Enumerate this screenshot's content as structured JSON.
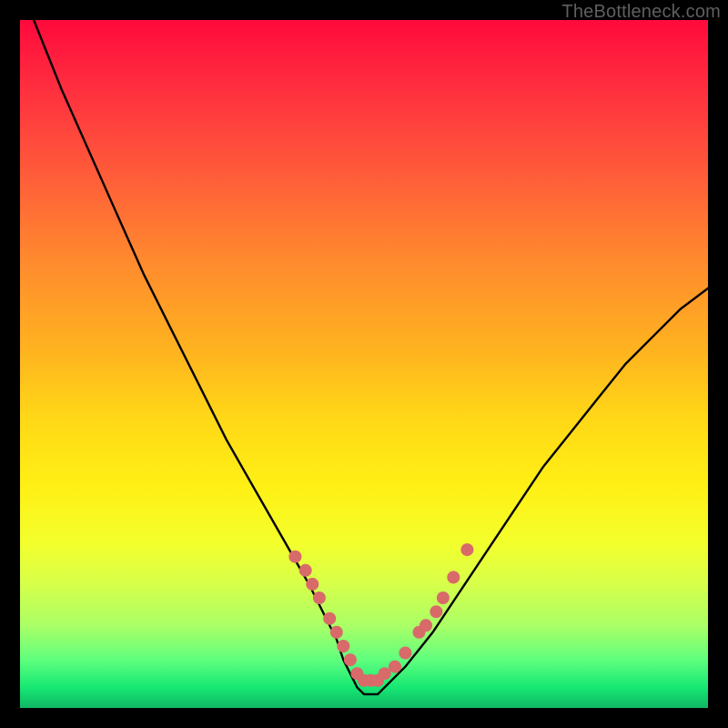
{
  "watermark": "TheBottleneck.com",
  "colors": {
    "frame_bg": "#000000",
    "marker": "#d86a6a",
    "line": "#000000",
    "gradient_top": "#ff0a3c",
    "gradient_bottom": "#0fb765"
  },
  "chart_data": {
    "type": "line",
    "title": "",
    "xlabel": "",
    "ylabel": "",
    "xlim": [
      0,
      100
    ],
    "ylim": [
      0,
      100
    ],
    "grid": false,
    "legend": false,
    "x": [
      2,
      6,
      10,
      14,
      18,
      22,
      26,
      30,
      34,
      38,
      42,
      46,
      47,
      48,
      49,
      50,
      51,
      52,
      53,
      54,
      56,
      60,
      64,
      68,
      72,
      76,
      80,
      84,
      88,
      92,
      96,
      100
    ],
    "y": [
      100,
      90,
      81,
      72,
      63,
      55,
      47,
      39,
      32,
      25,
      18,
      10,
      7,
      5,
      3,
      2,
      2,
      2,
      3,
      4,
      6,
      11,
      17,
      23,
      29,
      35,
      40,
      45,
      50,
      54,
      58,
      61
    ],
    "markers": {
      "x": [
        40,
        41.5,
        42.5,
        43.5,
        45,
        46,
        47,
        48,
        49,
        50,
        51,
        52,
        53,
        54.5,
        56,
        58,
        59,
        60.5,
        61.5,
        63,
        65
      ],
      "y": [
        22,
        20,
        18,
        16,
        13,
        11,
        9,
        7,
        5,
        4,
        4,
        4,
        5,
        6,
        8,
        11,
        12,
        14,
        16,
        19,
        23
      ]
    }
  }
}
